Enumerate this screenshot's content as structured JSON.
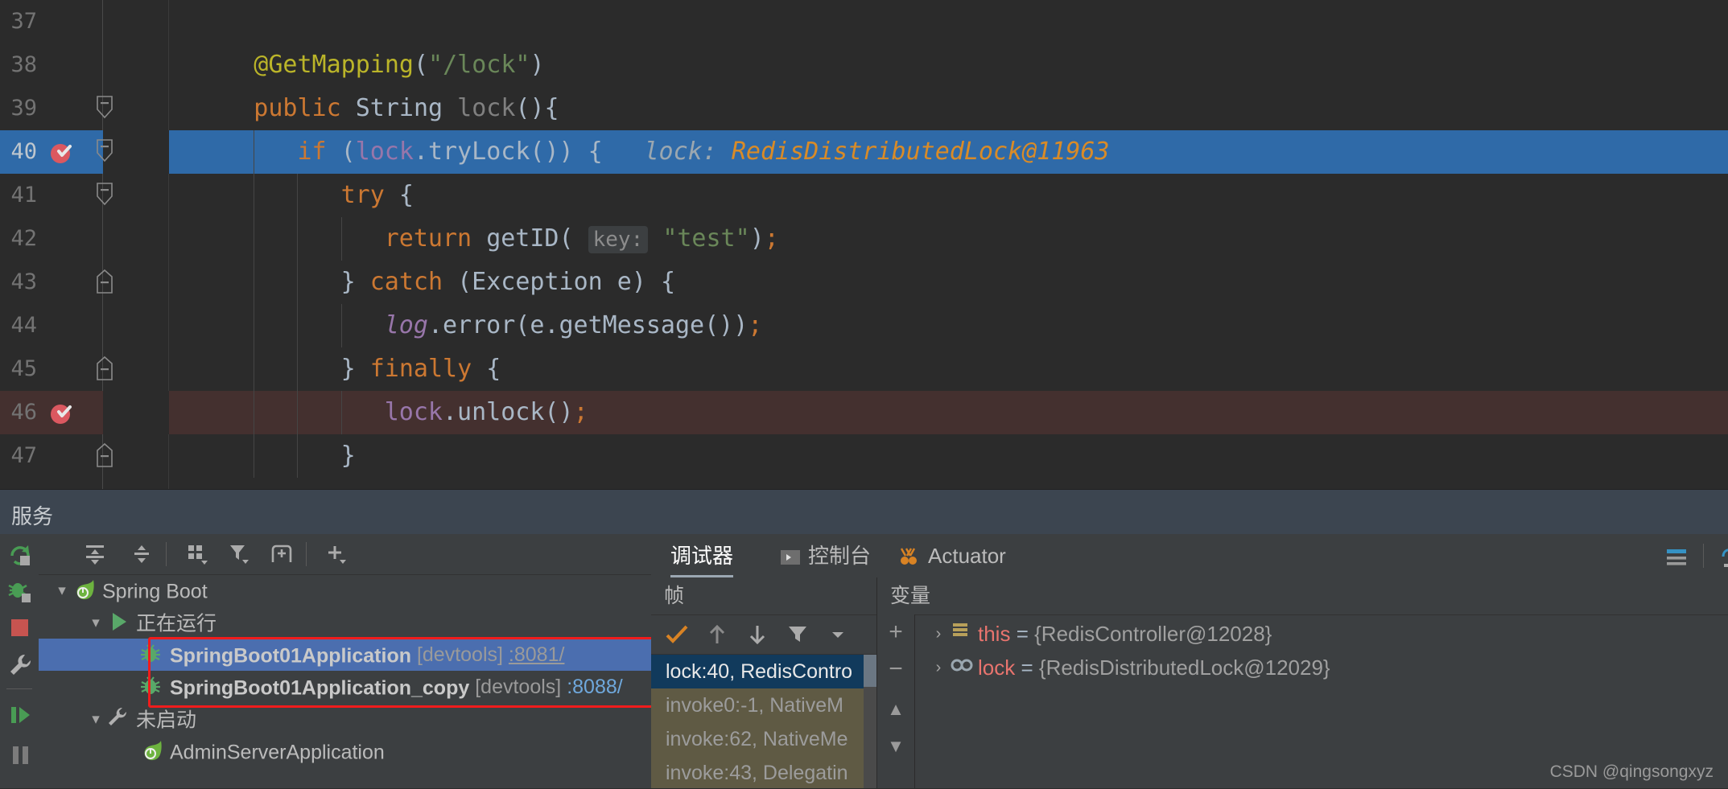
{
  "editor": {
    "lines": [
      {
        "num": "37",
        "text": "",
        "state": "normal",
        "bp": false,
        "fold": null
      },
      {
        "num": "38",
        "text": "@GetMapping(\"/lock\")",
        "state": "normal",
        "bp": false,
        "fold": null
      },
      {
        "num": "39",
        "text": "public String lock(){",
        "state": "normal",
        "bp": false,
        "fold": "minus"
      },
      {
        "num": "40",
        "text": "if (lock.tryLock()) {",
        "state": "selected",
        "bp": true,
        "fold": "minus"
      },
      {
        "num": "41",
        "text": "try {",
        "state": "normal",
        "bp": false,
        "fold": "minus"
      },
      {
        "num": "42",
        "text": "return getID( key: \"test\");",
        "state": "normal",
        "bp": false,
        "fold": null
      },
      {
        "num": "43",
        "text": "} catch (Exception e) {",
        "state": "normal",
        "bp": false,
        "fold": "minus"
      },
      {
        "num": "44",
        "text": "log.error(e.getMessage());",
        "state": "normal",
        "bp": false,
        "fold": null
      },
      {
        "num": "45",
        "text": "} finally {",
        "state": "normal",
        "bp": false,
        "fold": "minus"
      },
      {
        "num": "46",
        "text": "lock.unlock();",
        "state": "breakpoint-line",
        "bp": true,
        "fold": null
      },
      {
        "num": "47",
        "text": "}",
        "state": "normal",
        "bp": false,
        "fold": "minus"
      }
    ],
    "inline_hint": {
      "label": "lock:",
      "value": "RedisDistributedLock@11963"
    },
    "param_hint_42": "key:",
    "string_42": "\"test\""
  },
  "services_header": {
    "title": "服务"
  },
  "run_sidebar": {
    "buttons": [
      {
        "name": "rerun",
        "tip": "Rerun"
      },
      {
        "name": "debug",
        "tip": "Debug"
      },
      {
        "name": "stop",
        "tip": "Stop"
      },
      {
        "name": "settings",
        "tip": "Settings"
      },
      {
        "name": "resume",
        "tip": "Resume Program"
      },
      {
        "name": "pause",
        "tip": "Pause Program"
      }
    ]
  },
  "services_toolbar": {
    "buttons": [
      {
        "name": "expand-all",
        "label": "Expand All"
      },
      {
        "name": "collapse-all",
        "label": "Collapse All"
      },
      {
        "name": "group-by",
        "label": "Group By"
      },
      {
        "name": "filter",
        "label": "Filter"
      },
      {
        "name": "add-tab",
        "label": "Add Tab"
      },
      {
        "name": "add-service",
        "label": "Add Service"
      }
    ]
  },
  "services_tree": [
    {
      "indent": 0,
      "chevron": "v",
      "icon": "spring-boot-icon",
      "label": "Spring Boot",
      "bold": false,
      "selected": false,
      "suffix": "",
      "suffix2": "",
      "link": ""
    },
    {
      "indent": 1,
      "chevron": "v",
      "icon": "run-green-icon",
      "label": "正在运行",
      "bold": false,
      "selected": false,
      "suffix": "",
      "suffix2": "",
      "link": ""
    },
    {
      "indent": 2,
      "chevron": "",
      "icon": "bug-green-icon",
      "label": "SpringBoot01Application",
      "bold": true,
      "selected": true,
      "suffix": "[devtools]",
      "suffix2": "",
      "link": ":8081/",
      "linkStyle": "underline"
    },
    {
      "indent": 2,
      "chevron": "",
      "icon": "bug-green-icon",
      "label": "SpringBoot01Application_copy",
      "bold": true,
      "selected": false,
      "suffix": "[devtools]",
      "suffix2": "",
      "link": ":8088/",
      "linkStyle": "blue"
    },
    {
      "indent": 1,
      "chevron": "v",
      "icon": "wrench-icon",
      "label": "未启动",
      "bold": false,
      "selected": false,
      "suffix": "",
      "suffix2": "",
      "link": ""
    },
    {
      "indent": 2,
      "chevron": "",
      "icon": "spring-boot-icon",
      "label": "AdminServerApplication",
      "bold": false,
      "selected": false,
      "suffix": "",
      "suffix2": "",
      "link": ""
    }
  ],
  "debugger_tabs": [
    {
      "label": "调试器",
      "icon": "",
      "active": true
    },
    {
      "label": "控制台",
      "icon": "console-icon",
      "active": false
    },
    {
      "label": "Actuator",
      "icon": "actuator-icon",
      "active": false
    }
  ],
  "debugger_toolbar": [
    {
      "name": "layout-settings-icon"
    },
    {
      "name": "step-over-icon"
    },
    {
      "name": "step-into-icon"
    },
    {
      "name": "force-step-into-icon"
    },
    {
      "name": "step-out-icon"
    },
    {
      "name": "drop-frame-icon"
    },
    {
      "name": "run-to-cursor-icon"
    },
    {
      "name": "evaluate-expression-icon"
    }
  ],
  "frames_pane": {
    "title": "帧",
    "toolbar": [
      {
        "name": "checkmark-icon"
      },
      {
        "name": "arrow-up-icon"
      },
      {
        "name": "arrow-down-icon"
      },
      {
        "name": "filter-icon"
      },
      {
        "name": "chevron-down-icon"
      }
    ],
    "items": [
      {
        "text": "lock:40, RedisContro",
        "selected": true
      },
      {
        "text": "invoke0:-1, NativeM",
        "selected": false
      },
      {
        "text": "invoke:62, NativeMe",
        "selected": false
      },
      {
        "text": "invoke:43, Delegatin",
        "selected": false
      }
    ]
  },
  "variables_pane": {
    "title": "变量",
    "side_buttons": [
      {
        "name": "add-watch-icon",
        "glyph": "+"
      },
      {
        "name": "remove-watch-icon",
        "glyph": "−"
      },
      {
        "name": "move-up-icon",
        "glyph": "▲"
      },
      {
        "name": "move-down-icon",
        "glyph": "▼"
      }
    ],
    "items": [
      {
        "chevron": "›",
        "icon": "field-icon",
        "name": "this",
        "eq": " = ",
        "value": "{RedisController@12028}"
      },
      {
        "chevron": "›",
        "icon": "local-var-icon",
        "name": "lock",
        "eq": " = ",
        "value": "{RedisDistributedLock@12029}"
      }
    ]
  },
  "watermark": "CSDN @qingsongxyz",
  "colors": {
    "editor_bg": "#2B2B2B",
    "selected_line": "#2F6AA8",
    "breakpoint_line": "#44302F",
    "panel_bg": "#3C3F41",
    "header_bg": "#3C4550",
    "tree_selected": "#4B6EAF",
    "frame_list_bg": "#5F5A44",
    "frame_selected": "#113A5C",
    "red_box": "#F01C1C",
    "breakpoint_red": "#DB5860"
  }
}
